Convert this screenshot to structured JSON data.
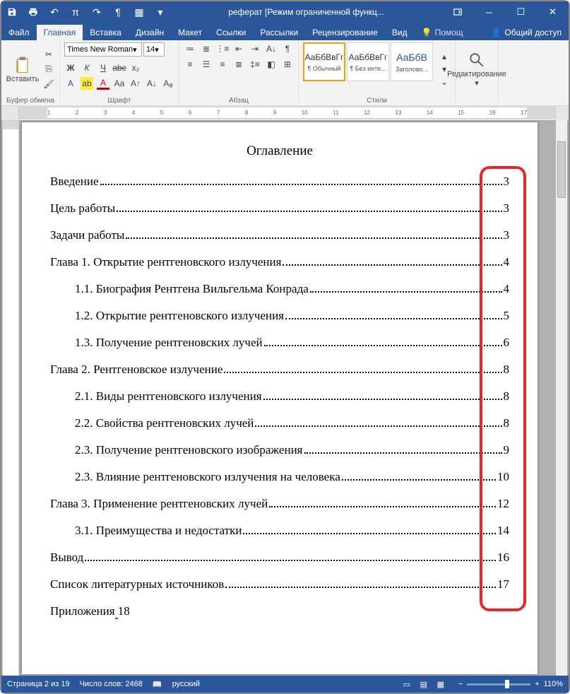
{
  "titlebar": {
    "title": "реферат [Режим ограниченной функц..."
  },
  "tabs": {
    "file": "Файл",
    "home": "Главная",
    "insert": "Вставка",
    "design": "Дизайн",
    "layout": "Макет",
    "refs": "Ссылки",
    "mail": "Рассылки",
    "review": "Рецензирование",
    "view": "Вид",
    "tell": "Помощ",
    "share": "Общий доступ"
  },
  "ribbon": {
    "clipboard": {
      "label": "Буфер обмена",
      "paste": "Вставить"
    },
    "font": {
      "label": "Шрифт",
      "name": "Times New Roman",
      "size": "14"
    },
    "para": {
      "label": "Абзац"
    },
    "styles": {
      "label": "Стили",
      "s1": "¶ Обычный",
      "s2": "¶ Без инте...",
      "s3": "Заголово...",
      "preview": "АаБбВвГг",
      "previewH": "АаБбВ"
    },
    "edit": {
      "label": "Редактирование"
    }
  },
  "document": {
    "title": "Оглавление",
    "toc": [
      {
        "text": "Введение",
        "page": "3",
        "sub": false
      },
      {
        "text": "Цель работы",
        "page": "3",
        "sub": false
      },
      {
        "text": "Задачи работы",
        "page": "3",
        "sub": false
      },
      {
        "text": "Глава 1. Открытие рентгеновского излучения",
        "page": "4",
        "sub": false
      },
      {
        "text": "1.1. Биография Рентгена Вильгельма Конрада",
        "page": "4",
        "sub": true
      },
      {
        "text": "1.2. Открытие рентгеновского излучения",
        "page": "5",
        "sub": true
      },
      {
        "text": "1.3. Получение рентгеновских лучей",
        "page": "6",
        "sub": true
      },
      {
        "text": "Глава 2. Рентгеновское излучение",
        "page": "8",
        "sub": false
      },
      {
        "text": "2.1. Виды рентгеновского излучения",
        "page": "8",
        "sub": true
      },
      {
        "text": "2.2. Свойства рентгеновских лучей",
        "page": "8",
        "sub": true
      },
      {
        "text": "2.3. Получение рентгеновского изображения",
        "page": "9",
        "sub": true
      },
      {
        "text": "2.3. Влияние рентгеновского излучения на человека",
        "page": "10",
        "sub": true
      },
      {
        "text": "Глава 3. Применение рентгеновских лучей",
        "page": "12",
        "sub": false
      },
      {
        "text": "3.1. Преимущества и недостатки",
        "page": "14",
        "sub": true
      },
      {
        "text": "Вывод",
        "page": "16",
        "sub": false
      },
      {
        "text": "Список литературных источников",
        "page": "17",
        "sub": false
      }
    ],
    "last": {
      "text": "Приложения",
      "page": "18"
    }
  },
  "status": {
    "page": "Страница 2 из 19",
    "words": "Число слов: 2468",
    "lang": "русский",
    "zoom": "110%"
  }
}
